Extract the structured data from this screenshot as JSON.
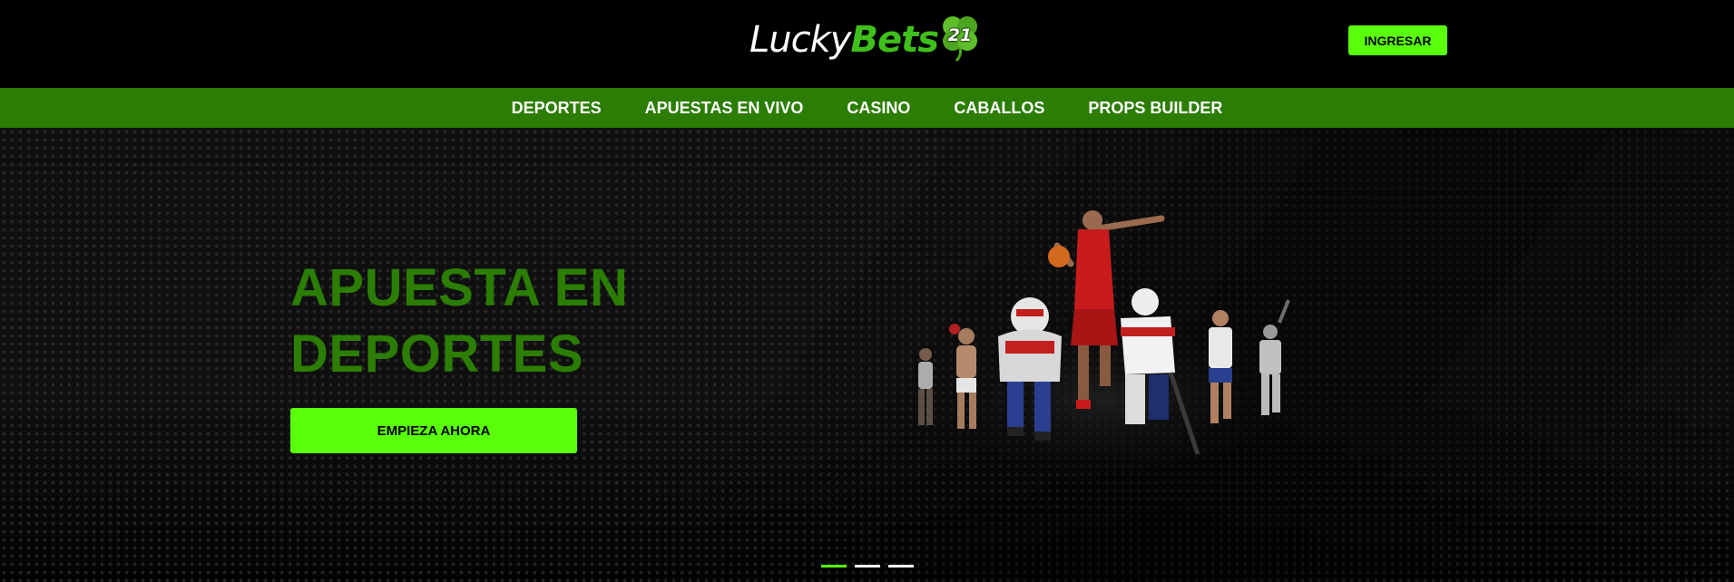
{
  "header": {
    "logo": {
      "word1": "Lucky",
      "word2": "Bets",
      "number": "21",
      "icon": "clover-icon"
    },
    "login_label": "INGRESAR"
  },
  "nav": {
    "items": [
      {
        "label": "DEPORTES"
      },
      {
        "label": "APUESTAS EN VIVO"
      },
      {
        "label": "CASINO"
      },
      {
        "label": "CABALLOS"
      },
      {
        "label": "PROPS BUILDER"
      }
    ]
  },
  "hero": {
    "title_line1": "APUESTA EN",
    "title_line2": "DEPORTES",
    "cta_label": "EMPIEZA AHORA",
    "image": "sports-athletes-collage",
    "slides": {
      "count": 3,
      "active": 1
    }
  },
  "colors": {
    "accent": "#5aff0a",
    "nav_bg": "#2b7d04",
    "title": "#2b7d04",
    "background": "#000000"
  }
}
